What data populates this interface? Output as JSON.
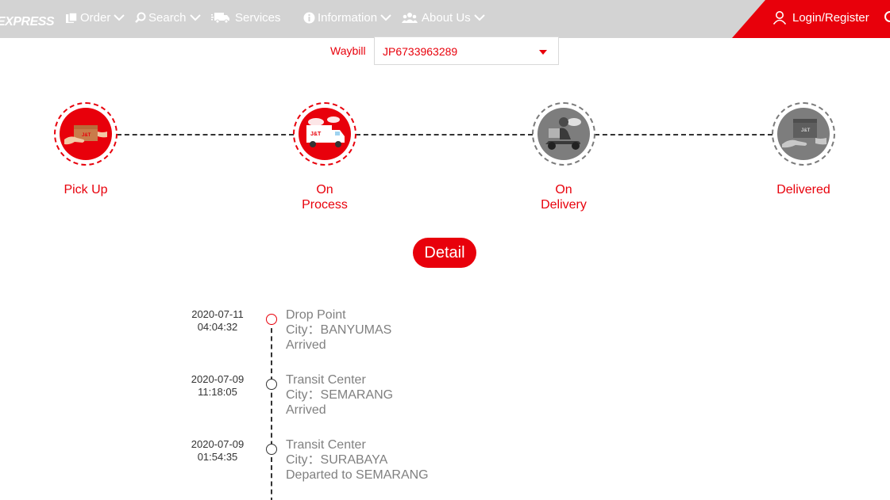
{
  "nav": {
    "logo": "EXPRESS",
    "items": [
      {
        "label": "Order",
        "icon": "order-icon"
      },
      {
        "label": "Search",
        "icon": "search-icon"
      },
      {
        "label": "Services",
        "icon": "truck-icon"
      },
      {
        "label": "Information",
        "icon": "info-icon"
      },
      {
        "label": "About Us",
        "icon": "people-icon"
      }
    ],
    "login": "Login/Register"
  },
  "waybill": {
    "label": "Waybill",
    "value": "JP6733963289"
  },
  "steps": [
    {
      "label_1": "Pick Up",
      "label_2": "",
      "status": "done",
      "icon": "pickup-icon"
    },
    {
      "label_1": "On",
      "label_2": "Process",
      "status": "done",
      "icon": "truck-process-icon"
    },
    {
      "label_1": "On",
      "label_2": "Delivery",
      "status": "pending",
      "icon": "courier-scooter-icon"
    },
    {
      "label_1": "Delivered",
      "label_2": "",
      "status": "pending",
      "icon": "handover-icon"
    }
  ],
  "detail_button": "Detail",
  "timeline": [
    {
      "date": "2020-07-11",
      "time": "04:04:32",
      "place": "Drop Point",
      "city": "City：BANYUMAS",
      "status": "Arrived"
    },
    {
      "date": "2020-07-09",
      "time": "11:18:05",
      "place": "Transit Center",
      "city": "City：SEMARANG",
      "status": "Arrived"
    },
    {
      "date": "2020-07-09",
      "time": "01:54:35",
      "place": "Transit Center",
      "city": "City：SURABAYA",
      "status": "Departed to SEMARANG"
    }
  ],
  "colors": {
    "accent": "#e8000b",
    "nav_bg": "#d3d3d3",
    "pending": "#7d7d7d",
    "muted_text": "#808080"
  }
}
